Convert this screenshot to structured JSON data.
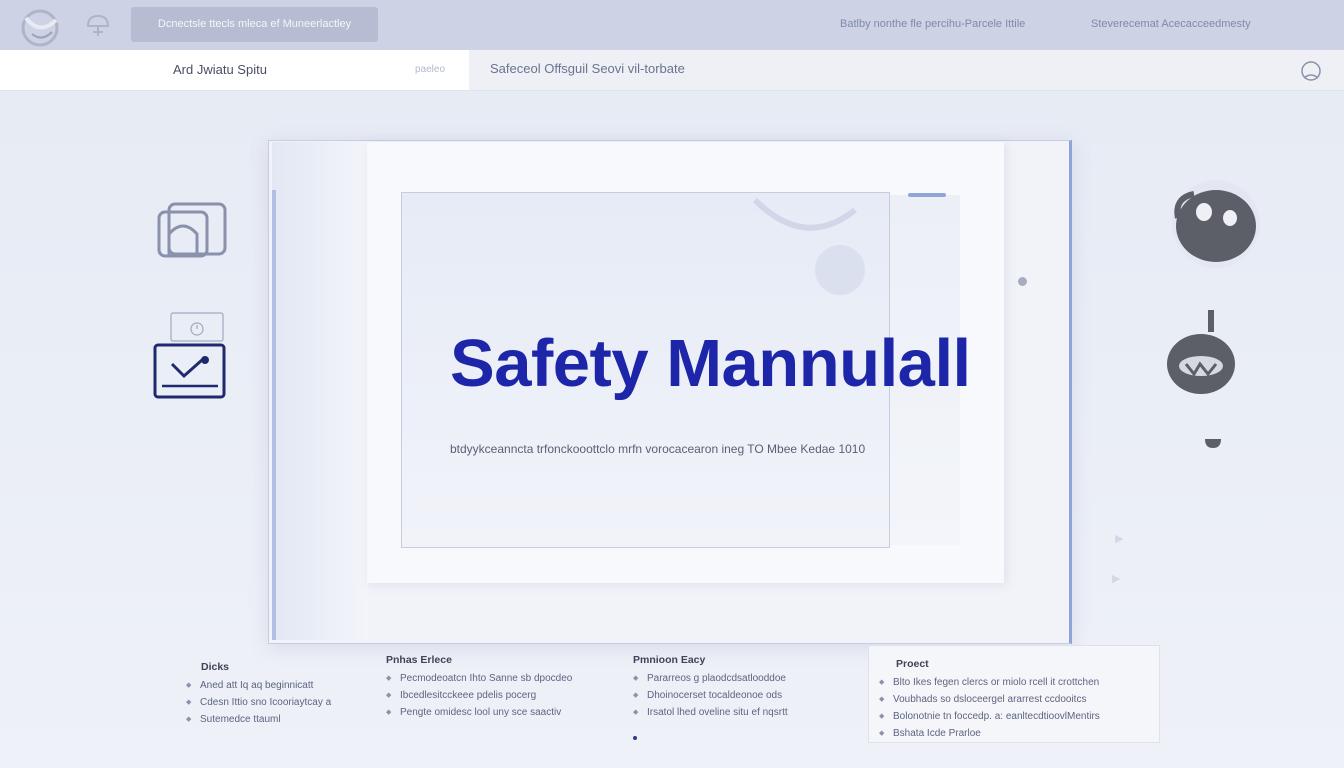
{
  "topbar": {
    "pill_label": "Dcnectsle ttecls mleca ef Muneerlactley",
    "links": [
      "Batlby nonthe fle percihu-Parcele Ittile",
      "Steverecemat Acecacceedmesty"
    ]
  },
  "subbar": {
    "title": "Ard Jwiatu Spitu",
    "tab": "paeleo",
    "document_label": "Safeceol Offsguil Seovi vil-torbate"
  },
  "document": {
    "title": "Safety Mannulall",
    "subtitle": "btdyykceanncta trfonckooottclo mrfn vorocacearon ineg TO Mbee Kedae 1010"
  },
  "info": {
    "col1": {
      "heading": "Dicks",
      "items": [
        "Aned att Iq aq beginnicatt",
        "Cdesn Ittio sno Icooriaytcay a",
        "Sutemedce ttauml"
      ]
    },
    "col2": {
      "heading": "Pnhas Erlece",
      "items": [
        "Pecmodeoatcn Ihto Sanne sb dpocdeo",
        "Ibcedlesitcckeee pdelis pocerg",
        "Pengte omidesc lool uny sce saactiv"
      ]
    },
    "col3": {
      "heading": "Pmnioon Eacy",
      "items": [
        "Pararreos g plaodcdsatlooddoe",
        "Dhoinocerset tocaldeonoe ods",
        "Irsatol lhed oveline situ ef nqsrtt"
      ]
    },
    "col4": {
      "heading": "Proect",
      "items": [
        "Blto Ikes fegen clercs or miolo rcell it crottchen",
        "Voubhads so dsloceergel ararrest ccdooitcs",
        "Bolonotnie tn foccedp. a: eanltecdtioovlMentirs",
        "Bshata Icde Prarloe"
      ]
    }
  }
}
